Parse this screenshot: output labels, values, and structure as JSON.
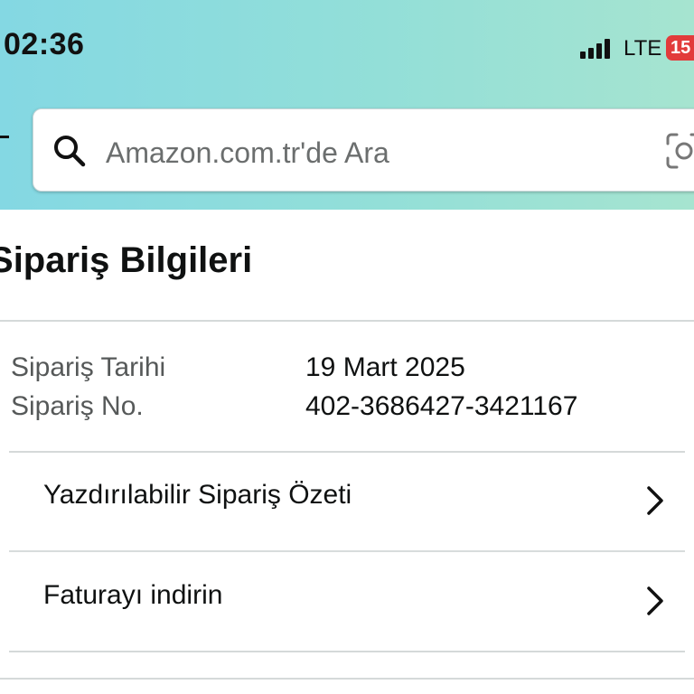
{
  "status_bar": {
    "time": "02:36",
    "network": "LTE",
    "battery": "15"
  },
  "search": {
    "placeholder": "Amazon.com.tr'de Ara",
    "icon": "search-icon",
    "camera_icon": "camera-icon"
  },
  "page": {
    "title": "ipariş Bilgileri"
  },
  "order_info": {
    "date_label": "Sipariş Tarihi",
    "date_value": "19 Mart 2025",
    "number_label": "Sipariş No.",
    "number_value": "402-3686427-3421167"
  },
  "actions": [
    {
      "label": "Yazdırılabilir Sipariş Özeti",
      "icon": "chevron-right-icon"
    },
    {
      "label": "Faturayı indirin",
      "icon": "chevron-right-icon"
    }
  ],
  "colors": {
    "header_gradient_start": "#84d8e3",
    "header_gradient_end": "#a6e4d0",
    "battery_low": "#e23b3b"
  }
}
